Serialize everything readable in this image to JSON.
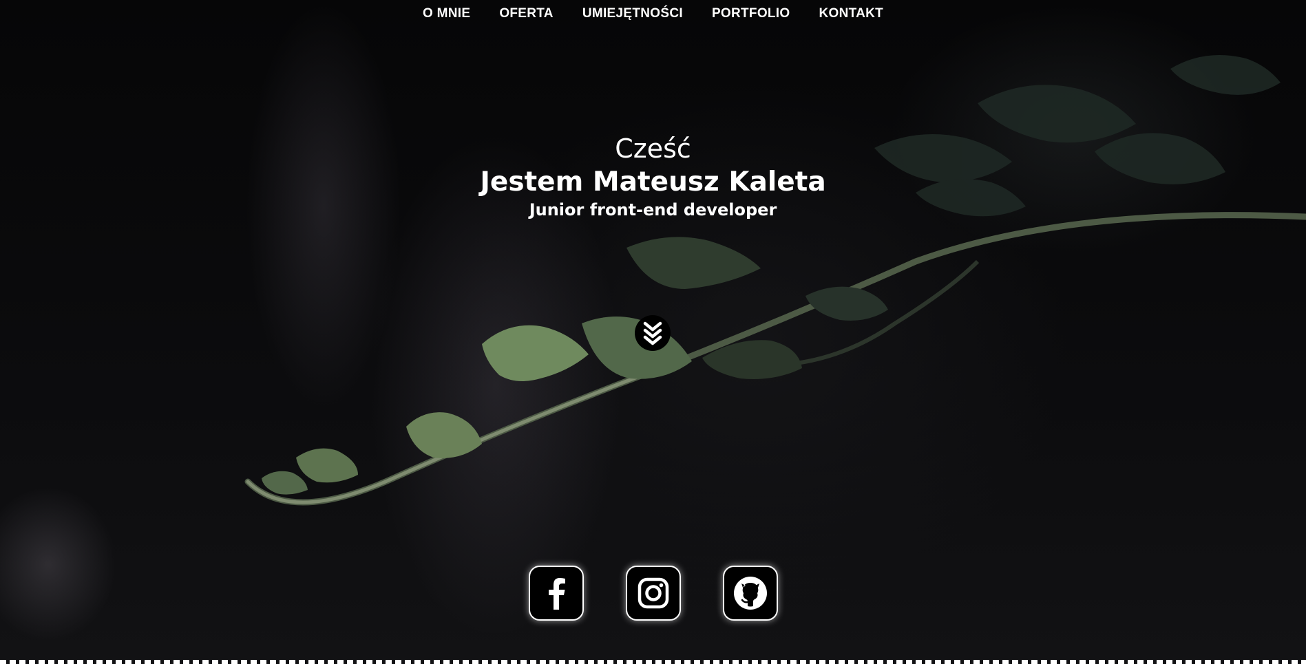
{
  "nav": {
    "items": [
      {
        "label": "O MNIE"
      },
      {
        "label": "OFERTA"
      },
      {
        "label": "UMIEJĘTNOŚCI"
      },
      {
        "label": "PORTFOLIO"
      },
      {
        "label": "KONTAKT"
      }
    ]
  },
  "hero": {
    "greeting": "Cześć",
    "name": "Jestem Mateusz Kaleta",
    "role": "Junior front-end developer",
    "scroll_icon": "double-chevron-down-icon"
  },
  "socials": [
    {
      "icon": "facebook-icon"
    },
    {
      "icon": "instagram-icon"
    },
    {
      "icon": "github-icon"
    }
  ],
  "colors": {
    "text": "#ffffff",
    "background": "#050506",
    "button_bg": "#000000",
    "leaf": "#6f8a5e"
  }
}
